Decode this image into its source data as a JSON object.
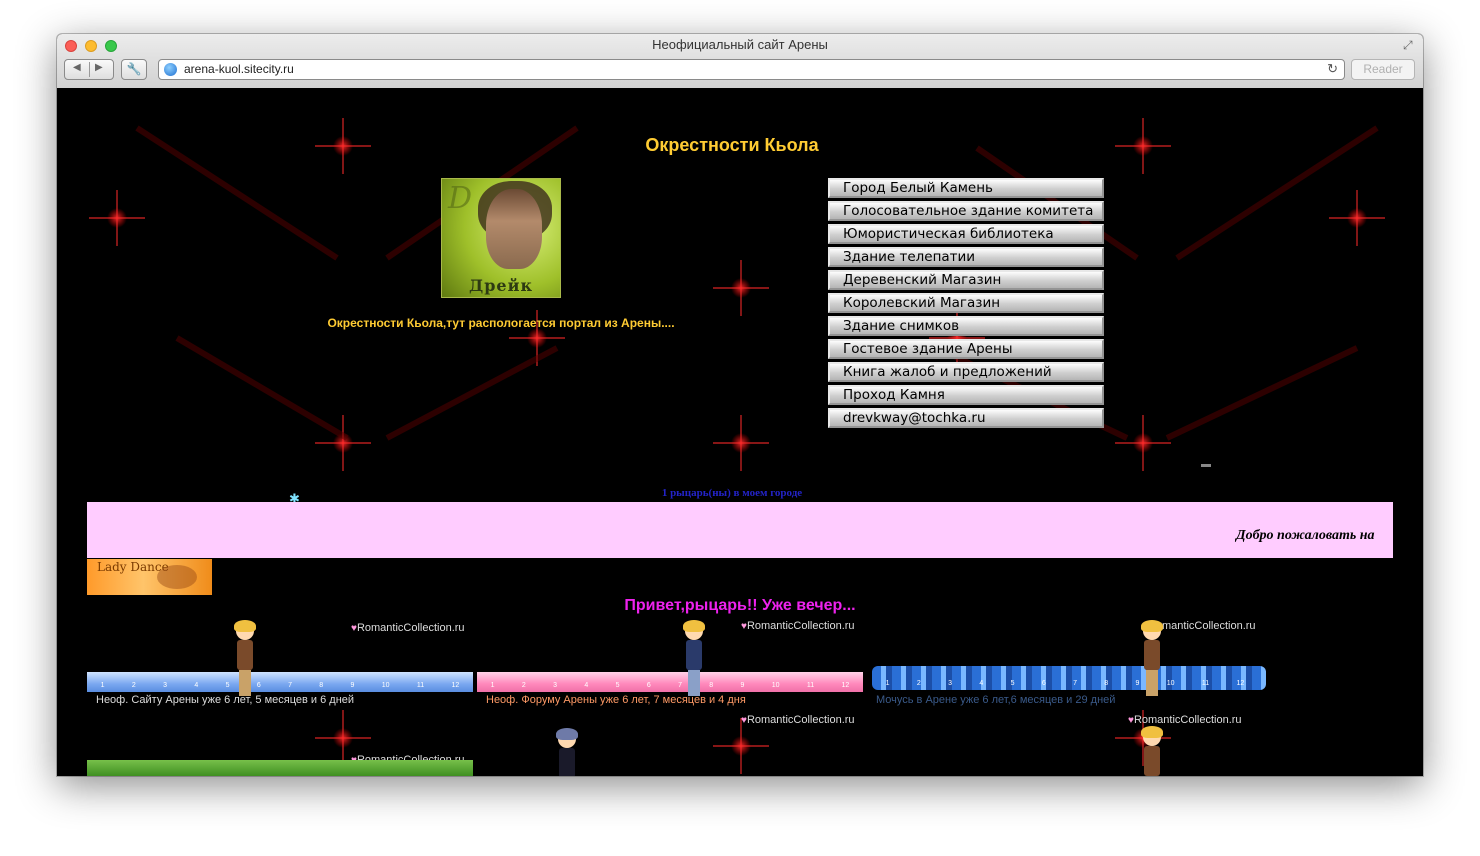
{
  "window": {
    "title": "Неофициальный сайт Арены",
    "url": "arena-kuol.sitecity.ru",
    "reader_label": "Reader"
  },
  "site": {
    "title": "Окрестности Кьола",
    "avatar_caption": "Дрейк",
    "intro": "Окрестности Кьола,тут распологается портал из Арены....",
    "menu": [
      "Город Белый Камень",
      "Голосовательное здание комитета",
      "Юмористическая библиотека",
      "Здание телепатии",
      "Деревенский Магазин",
      "Королевский Магазин",
      "Здание снимков",
      "Гостевое здание Арены",
      "Книга жалоб и предложений",
      "Проход Камня",
      "drevkway@tochka.ru"
    ],
    "knights_online": "1 рыцарь(ны) в моем городе",
    "marquee": "Добро пожаловать на",
    "lady_banner": "Lady Dance",
    "greeting": "Привет,рыцарь!! Уже вечер...",
    "romantic_label": "RomanticCollection.ru",
    "ruler_numbers": [
      "1",
      "2",
      "3",
      "4",
      "5",
      "6",
      "7",
      "8",
      "9",
      "10",
      "11",
      "12"
    ],
    "counters": [
      {
        "text": "Неоф. Сайту Арены уже 6 лет, 5 месяцев и 6 дней",
        "color": "#dddddd"
      },
      {
        "text": "Неоф. Форуму Арены уже 6 лет, 7 месяцев и 4 дня",
        "color": "#ff9a66"
      },
      {
        "text": "Мочусь в Арене уже 6 лет,6 месяцев и 29 дней",
        "color": "#3a5a8a"
      }
    ]
  },
  "colors": {
    "title": "#ffcc33",
    "marquee_bg": "#ffccff",
    "greeting": "#ee22ee",
    "knights": "#2323c8"
  }
}
